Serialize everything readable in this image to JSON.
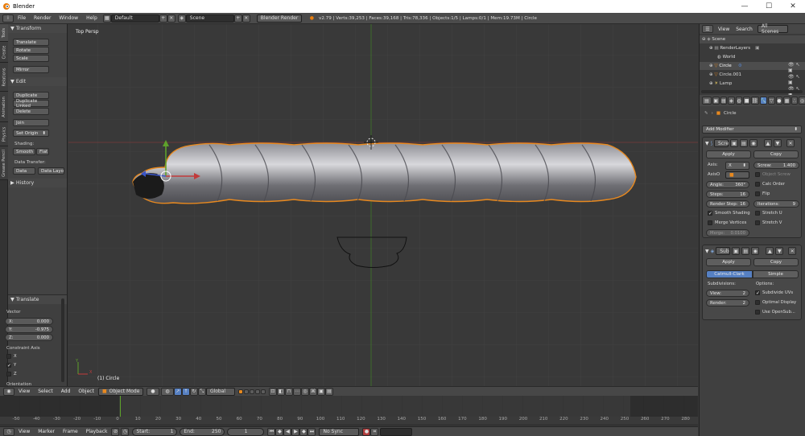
{
  "window": {
    "title": "Blender",
    "minimize": "—",
    "maximize": "☐",
    "close": "✕"
  },
  "menu": {
    "items": [
      "File",
      "Render",
      "Window",
      "Help"
    ],
    "screen_layout": "Default",
    "scene": "Scene",
    "engine": "Blender Render",
    "stats": "v2.79 | Verts:39,253 | Faces:39,168 | Tris:78,336 | Objects:1/5 | Lamps:0/1 | Mem:19.73M | Circle"
  },
  "vtabs": [
    "Tools",
    "Create",
    "Relations",
    "Animation",
    "Physics",
    "Grease Pencil"
  ],
  "toolpanel": {
    "transform_header": "Transform",
    "transform": [
      "Translate",
      "Rotate",
      "Scale"
    ],
    "mirror": "Mirror",
    "edit_header": "Edit",
    "edit": [
      "Duplicate",
      "Duplicate Linked",
      "Delete"
    ],
    "join": "Join",
    "set_origin": "Set Origin",
    "shading_label": "Shading:",
    "smooth": "Smooth",
    "flat": "Flat",
    "data_transfer_label": "Data Transfer:",
    "data": "Data",
    "data_layout": "Data Layo",
    "history": "History"
  },
  "operator": {
    "header": "Translate",
    "vector_label": "Vector",
    "x": {
      "label": "X:",
      "value": "0.000"
    },
    "y": {
      "label": "Y:",
      "value": "-0.975"
    },
    "z": {
      "label": "Z:",
      "value": "0.000"
    },
    "constraint_label": "Constraint Axis",
    "axes": [
      {
        "label": "X",
        "checked": false
      },
      {
        "label": "Y",
        "checked": true
      },
      {
        "label": "Z",
        "checked": false
      }
    ],
    "orientation_label": "Orientation"
  },
  "viewport": {
    "view_name": "Top Persp",
    "object_label": "(1) Circle",
    "axis_y": "Y",
    "axis_x": "X"
  },
  "view_header": {
    "items": [
      "View",
      "Select",
      "Add",
      "Object"
    ],
    "mode": "Object Mode",
    "orientation": "Global"
  },
  "timeline": {
    "ticks": [
      "-50",
      "-40",
      "-30",
      "-20",
      "-10",
      "0",
      "10",
      "20",
      "30",
      "40",
      "50",
      "60",
      "70",
      "80",
      "90",
      "100",
      "110",
      "120",
      "130",
      "140",
      "150",
      "160",
      "170",
      "180",
      "190",
      "200",
      "210",
      "220",
      "230",
      "240",
      "250",
      "260",
      "270",
      "280"
    ],
    "current_frame": 1
  },
  "timeline_header": {
    "items": [
      "View",
      "Marker",
      "Frame",
      "Playback"
    ],
    "start_label": "Start:",
    "start_value": "1",
    "end_label": "End:",
    "end_value": "250",
    "current": "1",
    "sync": "No Sync"
  },
  "outliner": {
    "tabs": [
      "View",
      "Search"
    ],
    "filter": "All Scenes",
    "rows": [
      {
        "name": "Scene",
        "indent": 0
      },
      {
        "name": "RenderLayers",
        "indent": 1
      },
      {
        "name": "World",
        "indent": 1
      },
      {
        "name": "Circle",
        "indent": 1
      },
      {
        "name": "Circle.001",
        "indent": 1
      },
      {
        "name": "Lamp",
        "indent": 1
      }
    ]
  },
  "properties": {
    "breadcrumb": "Circle",
    "add_modifier": "Add Modifier",
    "screw": {
      "name": "Scre",
      "apply": "Apply",
      "copy": "Copy",
      "axis_label": "Axis:",
      "axis_value": "X",
      "screw_label": "Screw:",
      "screw_value": "1.400",
      "axis_obj_label": "AxisO",
      "object_screw": "Object Screw",
      "angle_label": "Angle:",
      "angle_value": "360°",
      "calc_order": "Calc Order",
      "steps_label": "Steps:",
      "steps_value": "16",
      "flip": "Flip",
      "render_steps_label": "Render Step:",
      "render_steps_value": "16",
      "iterations_label": "Iterations:",
      "iterations_value": "9",
      "smooth_shading": "Smooth Shading",
      "stretch_u": "Stretch U",
      "merge_vertices": "Merge Vertices",
      "stretch_v": "Stretch V",
      "merge_label": "Merge:",
      "merge_value": "0.0100"
    },
    "subsurf": {
      "name": "Sub",
      "apply": "Apply",
      "copy": "Copy",
      "catmull": "Catmull-Clark",
      "simple": "Simple",
      "subdivisions_label": "Subdivisions:",
      "options_label": "Options:",
      "view_label": "View:",
      "view_value": "2",
      "render_label": "Render:",
      "render_value": "2",
      "subdivide_uvs": "Subdivide UVs",
      "optimal_display": "Optimal Display",
      "use_opensubdiv": "Use OpenSub..."
    }
  },
  "colors": {
    "accent": "#5680c2",
    "selection_outline": "#e8891f",
    "axis_red": "#b23c3c",
    "axis_green": "#5ea12b"
  }
}
